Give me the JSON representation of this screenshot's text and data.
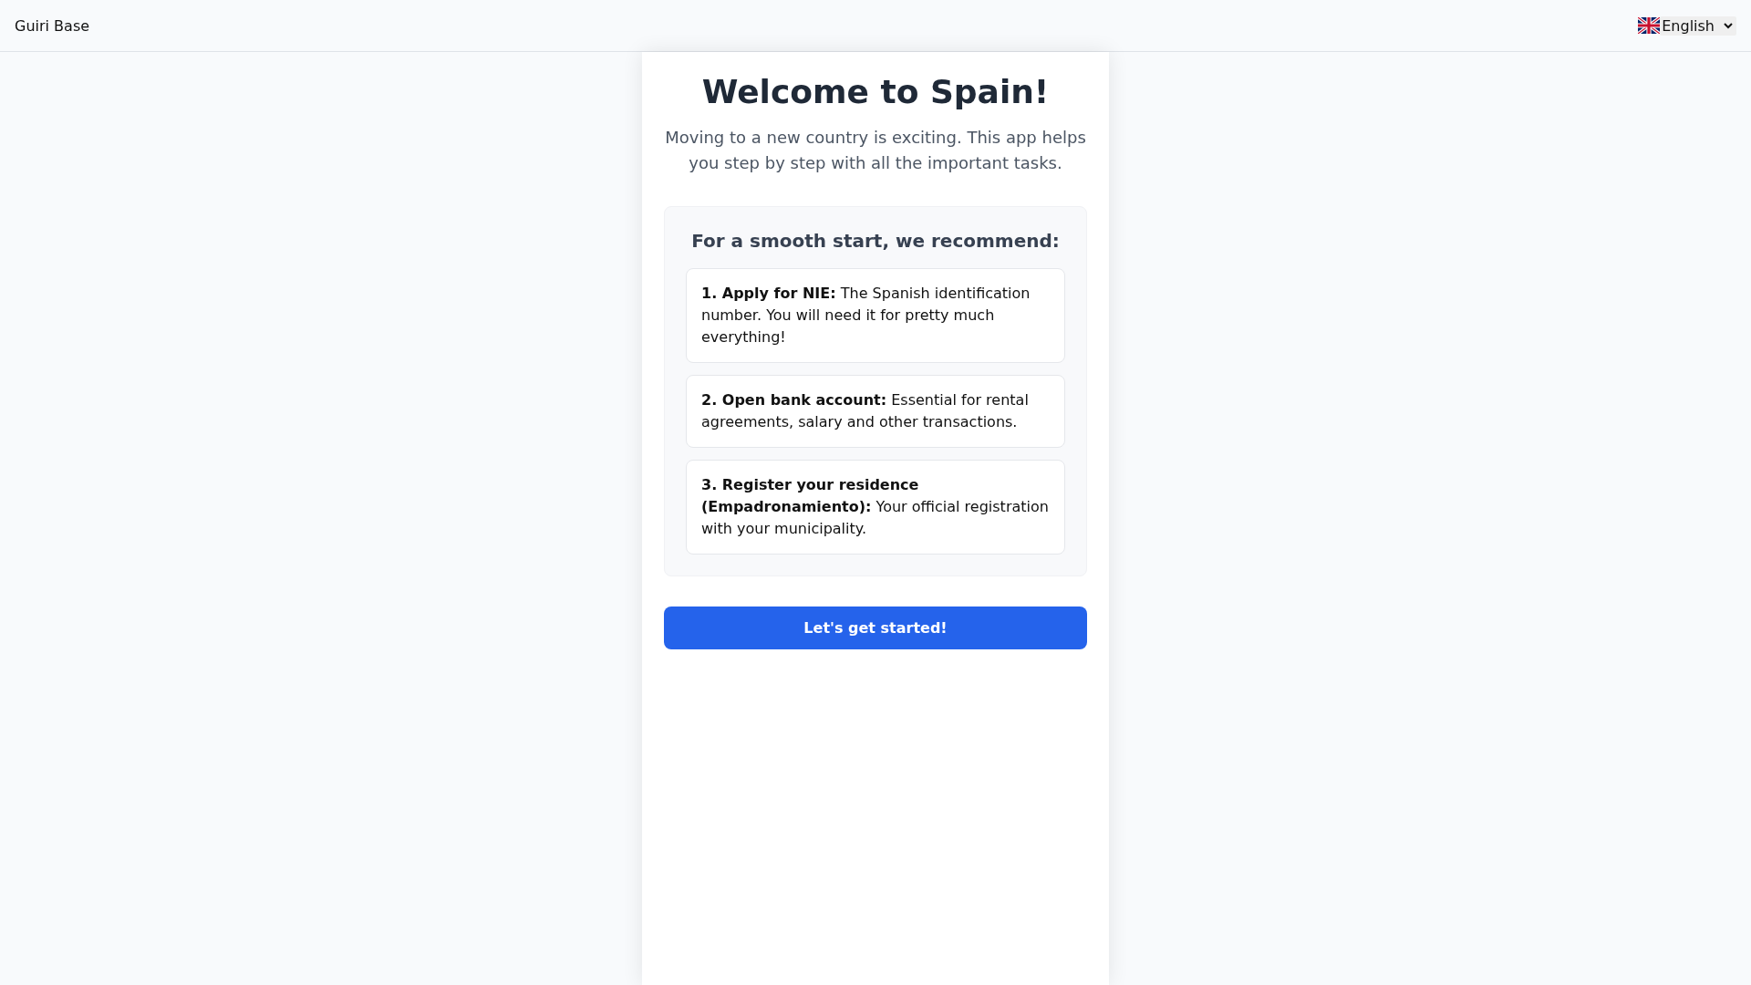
{
  "header": {
    "app_name": "Guiri Base",
    "language": "English"
  },
  "welcome": {
    "title": "Welcome to Spain!",
    "subtitle": "Moving to a new country is exciting. This app helps you step by step with all the important tasks."
  },
  "recommendations": {
    "heading": "For a smooth start, we recommend:",
    "items": [
      {
        "text": "**1. Apply for NIE:** The Spanish identification number. You will need it for pretty much everything!"
      },
      {
        "text": "**2. Open bank account:** Essential for rental agreements, salary and other transactions."
      },
      {
        "text": "**3. Register your residence (Empadronamiento):** Your official registration with your municipality."
      }
    ]
  },
  "start_button": {
    "label": "Let's get started!"
  }
}
